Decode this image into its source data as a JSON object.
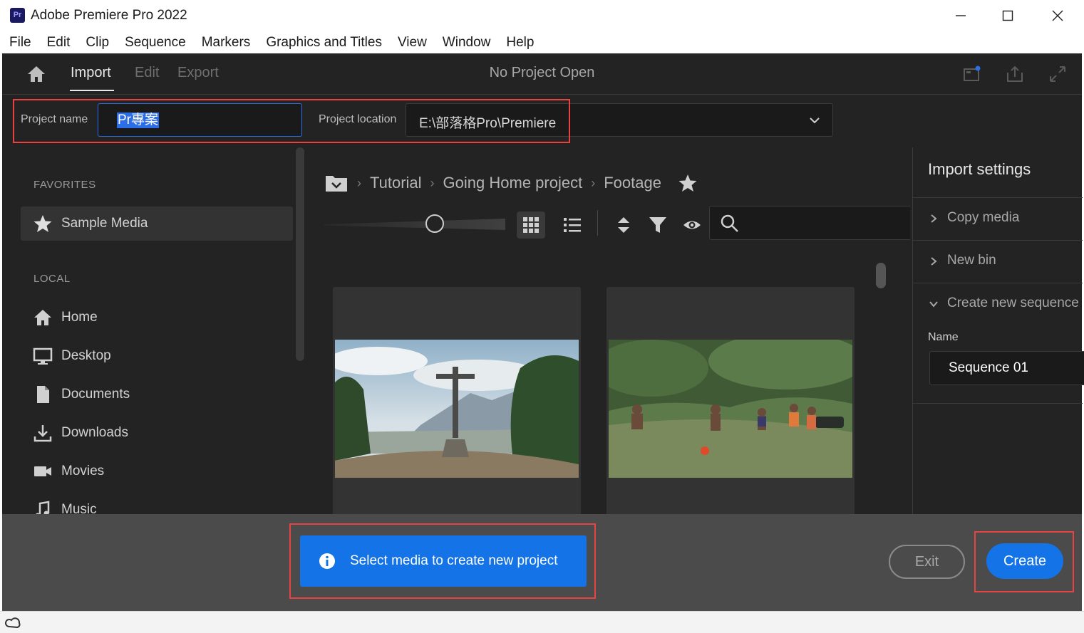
{
  "window": {
    "title": "Adobe Premiere Pro 2022",
    "app_badge": "Pr"
  },
  "menu": [
    "File",
    "Edit",
    "Clip",
    "Sequence",
    "Markers",
    "Graphics and Titles",
    "View",
    "Window",
    "Help"
  ],
  "nav": {
    "tabs": [
      "Import",
      "Edit",
      "Export"
    ],
    "active_tab": "Import",
    "status_title": "No Project Open"
  },
  "project": {
    "name_label": "Project name",
    "name_value": "Pr專案",
    "location_label": "Project location",
    "location_value": "E:\\部落格Pro\\Premiere"
  },
  "sidebar": {
    "favorites_heading": "FAVORITES",
    "favorites": [
      {
        "label": "Sample Media",
        "icon": "star-icon"
      }
    ],
    "local_heading": "LOCAL",
    "local": [
      {
        "label": "Home",
        "icon": "home-icon"
      },
      {
        "label": "Desktop",
        "icon": "monitor-icon"
      },
      {
        "label": "Documents",
        "icon": "document-icon"
      },
      {
        "label": "Downloads",
        "icon": "download-icon"
      },
      {
        "label": "Movies",
        "icon": "video-camera-icon"
      },
      {
        "label": "Music",
        "icon": "music-note-icon"
      }
    ]
  },
  "browser": {
    "breadcrumb": [
      "Tutorial",
      "Going Home project",
      "Footage"
    ],
    "view_mode": "grid",
    "search_placeholder": "",
    "media": [
      {
        "description": "cross-on-hill-thumbnail"
      },
      {
        "description": "kids-soccer-thumbnail"
      }
    ]
  },
  "import_settings": {
    "title": "Import settings",
    "rows": [
      {
        "label": "Copy media",
        "expanded": false
      },
      {
        "label": "New bin",
        "expanded": false
      },
      {
        "label": "Create new sequence",
        "expanded": true
      }
    ],
    "sequence_name_label": "Name",
    "sequence_name_value": "Sequence 01"
  },
  "footer": {
    "info_message": "Select media to create new project",
    "exit_label": "Exit",
    "create_label": "Create"
  },
  "colors": {
    "accent": "#1473e6",
    "highlight_box": "#e84242",
    "panel_bg": "#232323",
    "footer_bg": "#4b4b4b"
  }
}
